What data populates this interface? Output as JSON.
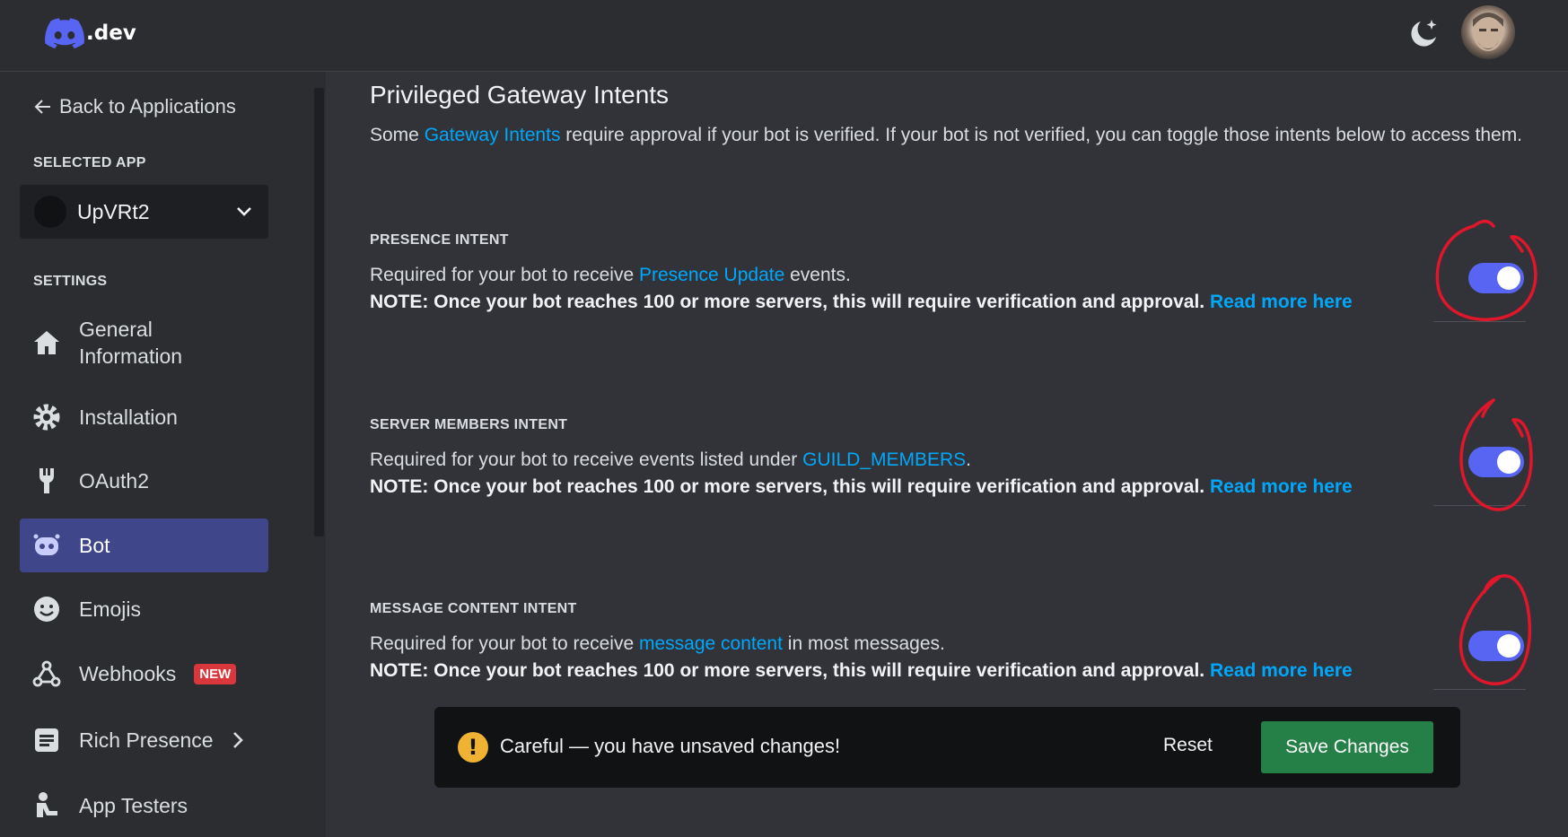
{
  "header": {
    "logo_text": ".dev",
    "theme_icon": "moon-sparkle-icon",
    "avatar_alt": "user avatar"
  },
  "sidebar": {
    "back_label": "Back to Applications",
    "selected_app_label": "SELECTED APP",
    "app_name": "UpVRt2",
    "settings_label": "SETTINGS",
    "items": [
      {
        "label": "General Information",
        "icon": "home-icon"
      },
      {
        "label": "Installation",
        "icon": "gear-icon"
      },
      {
        "label": "OAuth2",
        "icon": "wrench-icon"
      },
      {
        "label": "Bot",
        "icon": "bot-icon",
        "active": true
      },
      {
        "label": "Emojis",
        "icon": "emoji-icon"
      },
      {
        "label": "Webhooks",
        "icon": "webhook-icon",
        "badge": "NEW"
      },
      {
        "label": "Rich Presence",
        "icon": "list-icon"
      },
      {
        "label": "App Testers",
        "icon": "user-icon"
      }
    ]
  },
  "main": {
    "title": "Privileged Gateway Intents",
    "lead_prefix": "Some ",
    "lead_link": "Gateway Intents",
    "lead_suffix": " require approval if your bot is verified. If your bot is not verified, you can toggle those intents below to access them.",
    "note_text": "NOTE: Once your bot reaches 100 or more servers, this will require verification and approval.",
    "read_more": "Read more here",
    "intents": [
      {
        "title": "PRESENCE INTENT",
        "desc_prefix": "Required for your bot to receive ",
        "desc_link": "Presence Update",
        "desc_suffix": " events.",
        "enabled": true
      },
      {
        "title": "SERVER MEMBERS INTENT",
        "desc_prefix": "Required for your bot to receive events listed under ",
        "desc_link": "GUILD_MEMBERS",
        "desc_suffix": ".",
        "enabled": true
      },
      {
        "title": "MESSAGE CONTENT INTENT",
        "desc_prefix": "Required for your bot to receive ",
        "desc_link": "message content",
        "desc_suffix": " in most messages.",
        "enabled": true
      }
    ]
  },
  "unsaved_bar": {
    "message": "Careful — you have unsaved changes!",
    "warn_glyph": "!",
    "reset_label": "Reset",
    "save_label": "Save Changes"
  },
  "colors": {
    "accent": "#5865f2",
    "link": "#00a8fc",
    "save": "#248046",
    "annotation": "#e0162b"
  }
}
